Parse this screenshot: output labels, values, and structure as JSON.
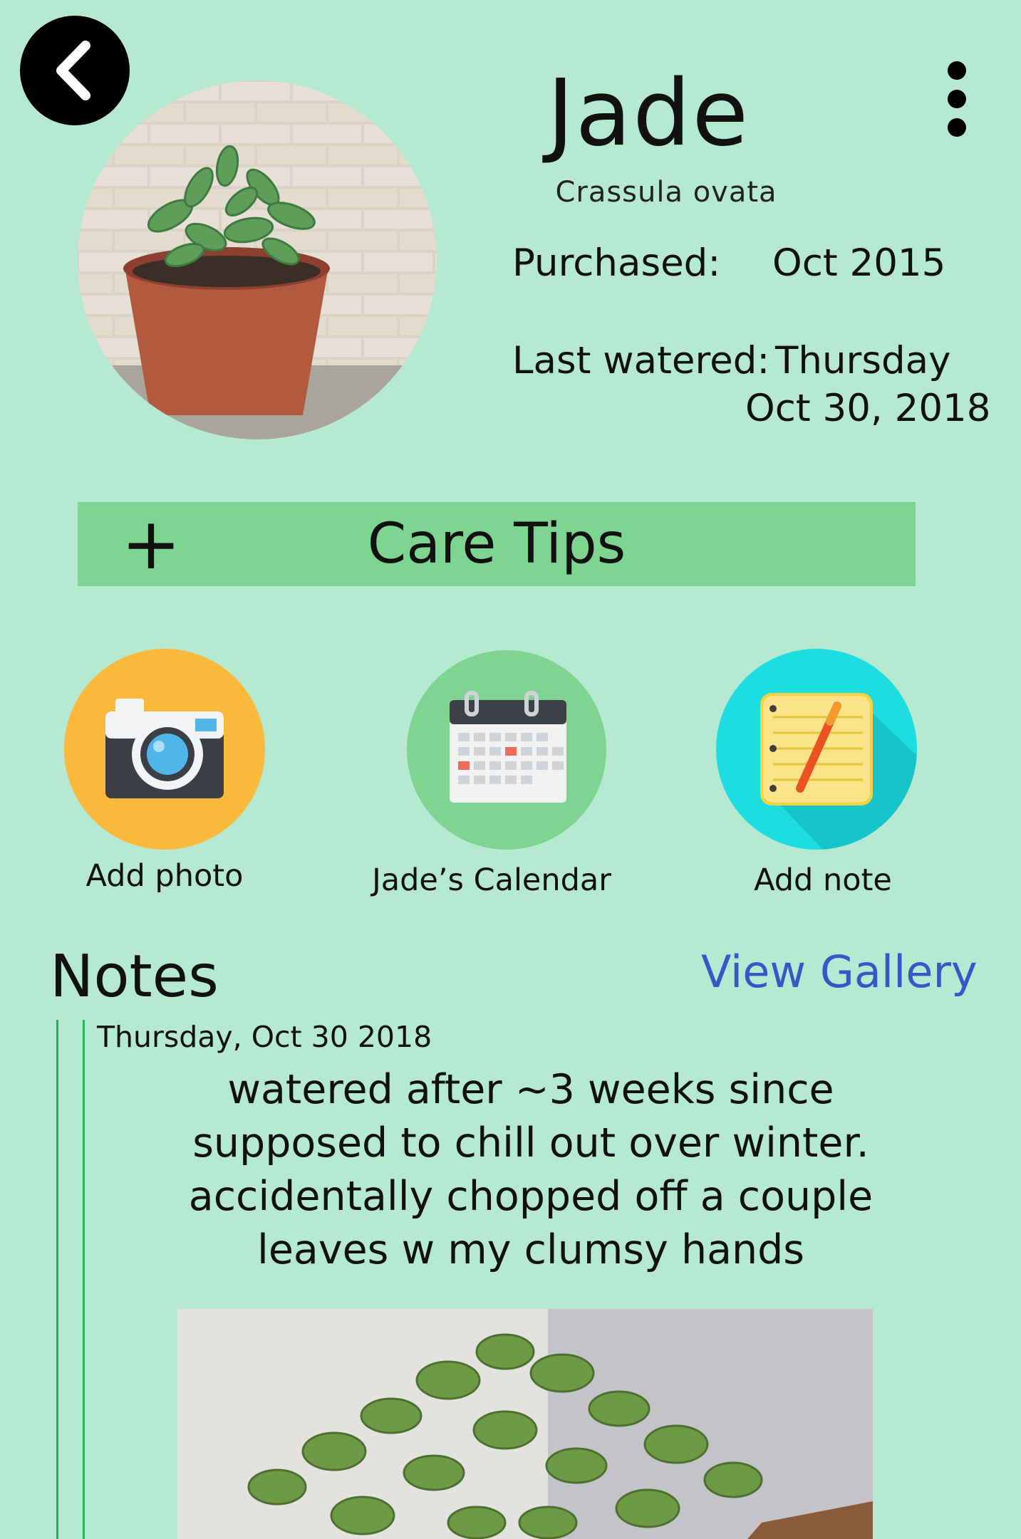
{
  "header": {
    "back_icon": "chevron-left-icon",
    "menu_icon": "more-vertical-icon",
    "plant_name": "Jade",
    "scientific_name": "Crassula ovata",
    "purchased_label": "Purchased:",
    "purchased_value": "Oct 2015",
    "last_watered_label": "Last watered:",
    "last_watered_day": "Thursday",
    "last_watered_date": "Oct 30, 2018"
  },
  "care_tips": {
    "icon": "plus-icon",
    "label": "Care Tips",
    "color": "#7ed491"
  },
  "actions": [
    {
      "label": "Add photo",
      "icon": "camera-icon",
      "color": "#fab93a"
    },
    {
      "label": "Jade’s Calendar",
      "icon": "calendar-icon",
      "color": "#7fd491"
    },
    {
      "label": "Add note",
      "icon": "notepad-icon",
      "color": "#1ddde0"
    }
  ],
  "notes": {
    "heading": "Notes",
    "view_gallery": "View Gallery",
    "link_color": "#3b55c8",
    "entries": [
      {
        "date": "Thursday, Oct 30 2018",
        "text": "watered after ~3 weeks since supposed to chill out over winter. accidentally chopped off a couple leaves w my clumsy hands"
      }
    ]
  },
  "colors": {
    "background": "#b5e9d1",
    "timeline": "#27b25a"
  }
}
